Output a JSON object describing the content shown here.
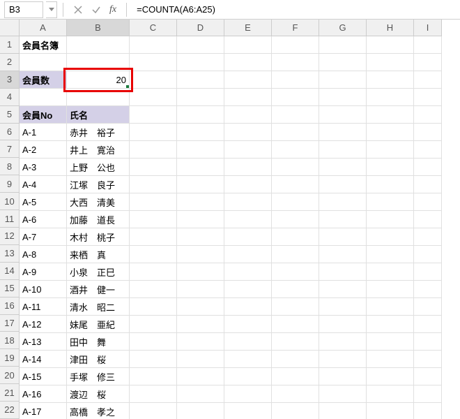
{
  "formulaBar": {
    "nameBox": "B3",
    "formula": "=COUNTA(A6:A25)",
    "fxLabel": "fx"
  },
  "columns": [
    "A",
    "B",
    "C",
    "D",
    "E",
    "F",
    "G",
    "H",
    "I"
  ],
  "rowNumbers": [
    "1",
    "2",
    "3",
    "4",
    "5",
    "6",
    "7",
    "8",
    "9",
    "10",
    "11",
    "12",
    "13",
    "14",
    "15",
    "16",
    "17",
    "18",
    "19",
    "20",
    "21",
    "22"
  ],
  "cells": {
    "A1": "会員名簿",
    "A3": "会員数",
    "B3": "20",
    "A5": "会員No",
    "B5": "氏名",
    "members": [
      {
        "no": "A-1",
        "name": "赤井　裕子"
      },
      {
        "no": "A-2",
        "name": "井上　寛治"
      },
      {
        "no": "A-3",
        "name": "上野　公也"
      },
      {
        "no": "A-4",
        "name": "江塚　良子"
      },
      {
        "no": "A-5",
        "name": "大西　清美"
      },
      {
        "no": "A-6",
        "name": "加藤　道長"
      },
      {
        "no": "A-7",
        "name": "木村　桃子"
      },
      {
        "no": "A-8",
        "name": "来栖　真"
      },
      {
        "no": "A-9",
        "name": "小泉　正巳"
      },
      {
        "no": "A-10",
        "name": "酒井　健一"
      },
      {
        "no": "A-11",
        "name": "清水　昭二"
      },
      {
        "no": "A-12",
        "name": "妹尾　亜紀"
      },
      {
        "no": "A-13",
        "name": "田中　舞"
      },
      {
        "no": "A-14",
        "name": "津田　桜"
      },
      {
        "no": "A-15",
        "name": "手塚　修三"
      },
      {
        "no": "A-16",
        "name": "渡辺　桜"
      },
      {
        "no": "A-17",
        "name": "高橋　孝之"
      }
    ]
  }
}
